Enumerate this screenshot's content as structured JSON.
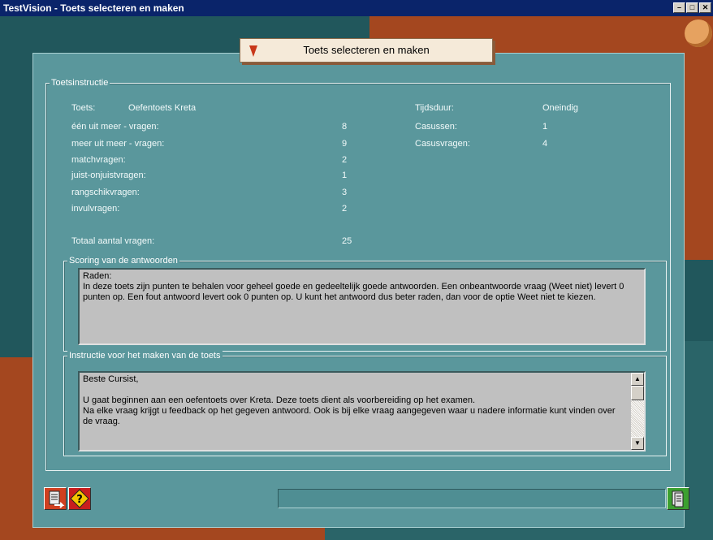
{
  "window": {
    "title": "TestVision - Toets selecteren en maken",
    "controls": [
      "minimize-icon",
      "maximize-icon",
      "close-icon"
    ]
  },
  "header": {
    "title": "Toets selecteren en maken"
  },
  "toetsinstructie": {
    "legend": "Toetsinstructie",
    "toets_label": "Toets:",
    "toets_value": "Oefentoets Kreta",
    "counts": [
      {
        "label": "één uit meer - vragen:",
        "value": "8"
      },
      {
        "label": "meer uit meer - vragen:",
        "value": "9"
      },
      {
        "label": "matchvragen:",
        "value": "2"
      },
      {
        "label": "juist-onjuistvragen:",
        "value": "1"
      },
      {
        "label": "rangschikvragen:",
        "value": "3"
      },
      {
        "label": "invulvragen:",
        "value": "2"
      }
    ],
    "total_label": "Totaal aantal vragen:",
    "total_value": "25",
    "right": [
      {
        "label": "Tijdsduur:",
        "value": "Oneindig"
      },
      {
        "label": "Casussen:",
        "value": "1"
      },
      {
        "label": "Casusvragen:",
        "value": "4"
      }
    ]
  },
  "scoring": {
    "legend": "Scoring van de antwoorden",
    "text": "Raden:\nIn deze toets zijn punten te behalen voor geheel goede en gedeeltelijk goede antwoorden. Een onbeantwoorde vraag (Weet niet) levert 0 punten op. Een fout antwoord levert ook 0 punten op. U kunt het antwoord dus beter raden, dan voor de optie Weet niet te kiezen."
  },
  "instructie": {
    "legend": "Instructie voor het maken van de toets",
    "text": "Beste Cursist,\n\nU gaat beginnen aan een oefentoets over Kreta. Deze toets dient als voorbereiding op het examen.\nNa elke vraag krijgt u feedback op het gegeven antwoord. Ook is bij elke vraag aangegeven waar u nadere informatie kunt vinden over de vraag."
  },
  "colors": {
    "accent": "#c8381a",
    "panel": "#5a979c",
    "titlebar": "#0a246a"
  }
}
